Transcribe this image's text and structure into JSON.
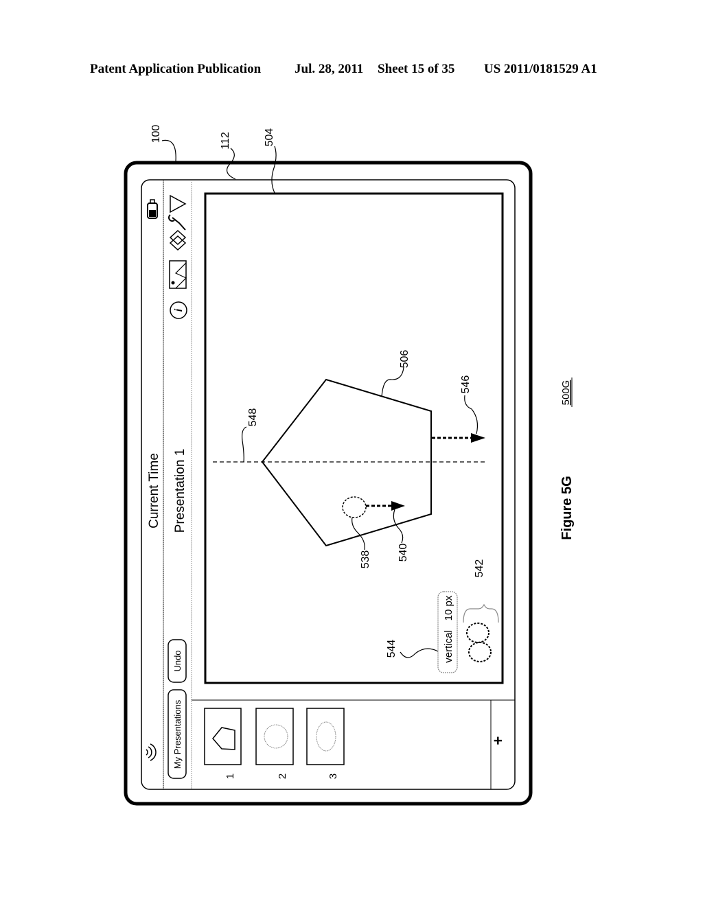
{
  "header": {
    "publication": "Patent Application Publication",
    "date": "Jul. 28, 2011",
    "sheet": "Sheet 15 of 35",
    "number": "US 2011/0181529 A1"
  },
  "figure": {
    "title": "Figure 5G",
    "id_label": "500G"
  },
  "device": {
    "status_bar": {
      "center_text": "Current Time",
      "left_icon": "wifi-icon",
      "right_icon": "battery-icon"
    },
    "toolbar": {
      "my_presentations_label": "My Presentations",
      "undo_label": "Undo",
      "title": "Presentation 1",
      "icons": [
        "info-icon",
        "media-icon",
        "layers-icon",
        "wrench-icon",
        "play-icon"
      ]
    },
    "slides": [
      {
        "number": "1",
        "thumbnail": "pentagon"
      },
      {
        "number": "2",
        "thumbnail": "circle"
      },
      {
        "number": "3",
        "thumbnail": "ellipse"
      }
    ],
    "add_slide_label": "+",
    "canvas": {
      "shape": "pentagon",
      "guide": "vertical dashed guide line",
      "callout": {
        "orientation": "vertical",
        "offset": "10 px"
      }
    }
  },
  "reference_labels": {
    "device": "100",
    "display": "112",
    "canvas": "504",
    "object": "506",
    "contact": "538",
    "contact_movement": "540",
    "contacts": "542",
    "callout": "544",
    "object_movement": "546",
    "guide_line": "548"
  }
}
